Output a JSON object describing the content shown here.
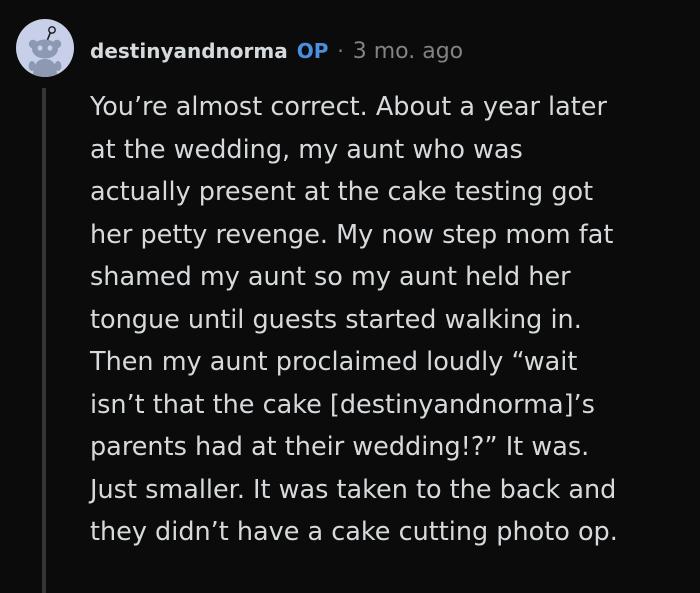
{
  "comment": {
    "author": "destinyandnorma",
    "badge": "OP",
    "separator": "·",
    "timestamp": "3 mo. ago",
    "avatar_icon": "snoo-avatar-icon",
    "body_lines": [
      "You’re almost correct. About a year later",
      "at the wedding, my aunt who was",
      "actually present at the cake testing got",
      "her petty revenge. My now step mom fat",
      "shamed my aunt so my aunt held her",
      "tongue until guests started walking in.",
      "Then my aunt proclaimed loudly “wait",
      "isn’t that the cake [destinyandnorma]’s",
      "parents had at their wedding!?” It was.",
      "Just smaller. It was taken to the back and",
      "they didn’t have a cake cutting photo op."
    ]
  },
  "colors": {
    "background": "#0b0b0b",
    "text": "#d7dadc",
    "op_badge": "#4a8fe0",
    "meta": "#818384",
    "thread_line": "#343536",
    "avatar_bg": "#c7d0e8"
  }
}
